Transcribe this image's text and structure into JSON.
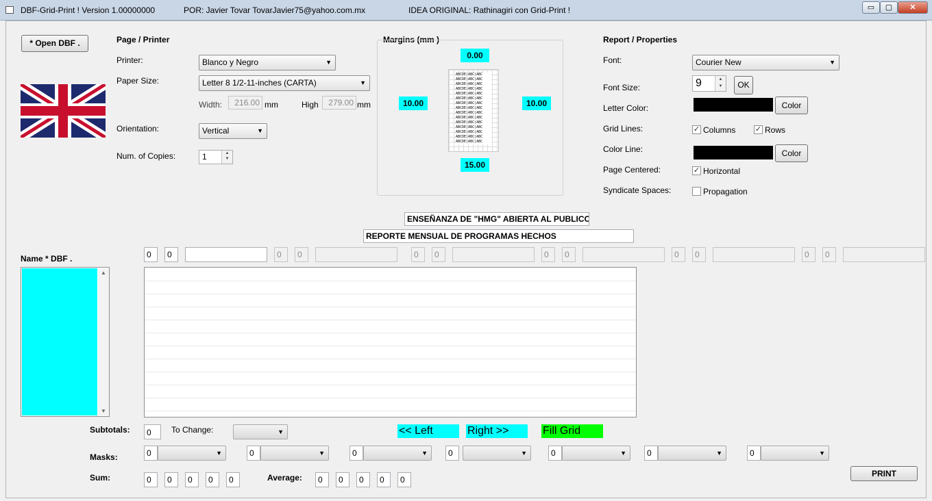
{
  "window": {
    "title": "DBF-Grid-Print ! Version 1.00000000",
    "author": "POR: Javier Tovar TovarJavier75@yahoo.com.mx",
    "idea": "IDEA ORIGINAL: Rathinagiri con Grid-Print !",
    "controls": {
      "minimize": "▭",
      "maximize": "▢",
      "close": "✕"
    }
  },
  "open_button": "* Open DBF .",
  "flag_icon": "uk-flag-icon",
  "page_printer": {
    "heading": "Page / Printer",
    "printer_label": "Printer:",
    "printer_value": "Blanco y Negro",
    "paper_label": "Paper Size:",
    "paper_value": "Letter 8 1/2-11-inches (CARTA)",
    "width_label": "Width:",
    "width_value": "216.00",
    "width_unit": "mm",
    "high_label": "High",
    "high_value": "279.00",
    "high_unit": "mm",
    "orientation_label": "Orientation:",
    "orientation_value": "Vertical",
    "copies_label": "Num. of Copies:",
    "copies_value": "1"
  },
  "margins": {
    "heading": "Margins (mm )",
    "top": "0.00",
    "left": "10.00",
    "right": "10.00",
    "bottom": "15.00",
    "preview_cell": "ABCDE|ABC|ABC"
  },
  "report": {
    "heading": "Report / Properties",
    "font_label": "Font:",
    "font_value": "Courier New",
    "font_size_label": "Font Size:",
    "font_size_value": "9",
    "ok_button": "OK",
    "letter_color_label": "Letter Color:",
    "color_button": "Color",
    "letter_color": "#000000",
    "grid_lines_label": "Grid Lines:",
    "columns_label": "Columns",
    "rows_label": "Rows",
    "color_line_label": "Color Line:",
    "line_color": "#000000",
    "page_centered_label": "Page Centered:",
    "horizontal_label": "Horizontal",
    "syndicate_label": "Syndicate Spaces:",
    "propagation_label": "Propagation"
  },
  "titles": {
    "title1": "ENSEÑANZA DE \"HMG\" ABIERTA AL PUBLICO",
    "title2": "REPORTE MENSUAL DE PROGRAMAS HECHOS"
  },
  "name_dbf_label": "Name * DBF .",
  "header_zero": "0",
  "bottom": {
    "subtotals_label": "Subtotals:",
    "subtotals_value": "0",
    "to_change_label": "To Change:",
    "left_button": "<< Left",
    "right_button": "Right >>",
    "fill_grid_button": "Fill Grid",
    "masks_label": "Masks:",
    "sum_label": "Sum:",
    "average_label": "Average:",
    "print_button": "PRINT"
  },
  "colors": {
    "cyan": "#00ffff",
    "green": "#00ff00",
    "titlebar": "#c9d6e6"
  }
}
